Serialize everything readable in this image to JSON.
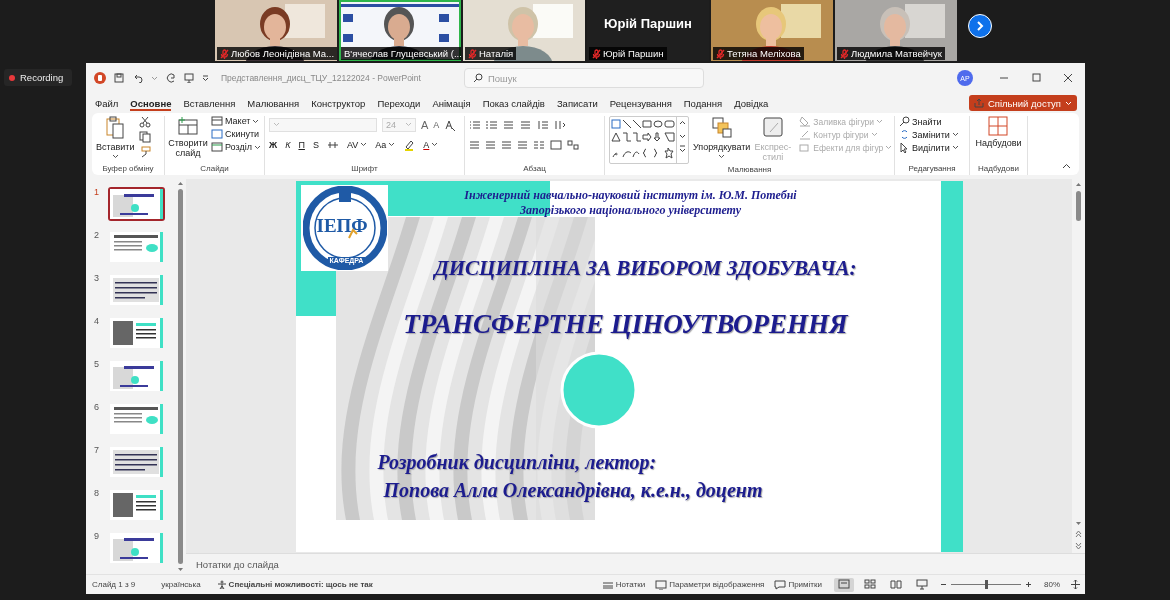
{
  "meeting": {
    "participants": [
      {
        "name": "Любов Леонідівна Ма...",
        "muted": true,
        "video_on": true,
        "speaking": false
      },
      {
        "name": "В'ячеслав Глущевський (...",
        "muted": false,
        "video_on": true,
        "speaking": true
      },
      {
        "name": "Наталія",
        "muted": true,
        "video_on": true,
        "speaking": false
      },
      {
        "name": "Юрій Паршин",
        "muted": true,
        "video_on": false,
        "speaking": false,
        "display_name": "Юрій Паршин"
      },
      {
        "name": "Тетяна Меліхова",
        "muted": true,
        "video_on": true,
        "speaking": false
      },
      {
        "name": "Людмила Матвейчук",
        "muted": true,
        "video_on": true,
        "speaking": false
      }
    ],
    "recording": {
      "label": "Recording"
    }
  },
  "window": {
    "title": "Представлення_дисц_ТЦУ_12122024  -  PowerPoint",
    "search": {
      "placeholder": "Пошук"
    },
    "avatar": "AP",
    "tabs": [
      {
        "label": "Файл",
        "selected": false
      },
      {
        "label": "Основне",
        "selected": true
      },
      {
        "label": "Вставлення",
        "selected": false
      },
      {
        "label": "Малювання",
        "selected": false
      },
      {
        "label": "Конструктор",
        "selected": false
      },
      {
        "label": "Переходи",
        "selected": false
      },
      {
        "label": "Анімація",
        "selected": false
      },
      {
        "label": "Показ слайдів",
        "selected": false
      },
      {
        "label": "Записати",
        "selected": false
      },
      {
        "label": "Рецензування",
        "selected": false
      },
      {
        "label": "Подання",
        "selected": false
      },
      {
        "label": "Довідка",
        "selected": false
      }
    ],
    "share_button": "Спільний доступ"
  },
  "ribbon": {
    "clipboard": {
      "label": "Буфер обміну",
      "paste": "Вставити"
    },
    "slides": {
      "label": "Слайди",
      "new_slide": "Створити слайд",
      "layout": "Макет",
      "reset": "Скинути",
      "section": "Розділ"
    },
    "font": {
      "label": "Шрифт",
      "size": "24",
      "grow": "A",
      "shrink": "A",
      "bold": "Ж",
      "italic": "К",
      "underline": "П",
      "strike": "S",
      "spacing": "AV",
      "case": "Aa",
      "font_color": "A"
    },
    "paragraph": {
      "label": "Абзац"
    },
    "drawing": {
      "label": "Малювання",
      "arrange": "Упорядкувати",
      "quick_styles": {
        "label": "Експрес-стилі",
        "disabled": true
      },
      "fill": {
        "label": "Заливка фігури",
        "disabled": true
      },
      "outline": {
        "label": "Контур фігури",
        "disabled": true
      },
      "effects": {
        "label": "Ефекти для фігур",
        "disabled": true
      }
    },
    "editing": {
      "label": "Редагування",
      "find": "Знайти",
      "replace": "Замінити",
      "select": "Виділити"
    },
    "addins": {
      "label": "Надбудови",
      "button": "Надбудови"
    }
  },
  "thumbnails": [
    {
      "number": "1",
      "selected": true
    },
    {
      "number": "2",
      "selected": false
    },
    {
      "number": "3",
      "selected": false
    },
    {
      "number": "4",
      "selected": false
    },
    {
      "number": "5",
      "selected": false
    },
    {
      "number": "6",
      "selected": false
    },
    {
      "number": "7",
      "selected": false
    },
    {
      "number": "8",
      "selected": false
    },
    {
      "number": "9",
      "selected": false
    }
  ],
  "slide": {
    "header": [
      "Інженерний навчально-науковий інститут ім. Ю.М. Потебні",
      "Запорізького національного університету"
    ],
    "logo": {
      "text": "ІЕПФ",
      "caption": "КАФЕДРА"
    },
    "title": "ДИСЦИПЛІНА ЗА ВИБОРОМ ЗДОБУВАЧА:",
    "subtitle": "ТРАНСФЕРТНЕ ЦІНОУТВОРЕННЯ",
    "author_lines": [
      "Розробник дисципліни, лектор:",
      "Попова Алла Олександрівна, к.е.н., доцент"
    ]
  },
  "notes_pane": {
    "placeholder": "Нотатки до слайда"
  },
  "status_bar": {
    "slide_info": "Слайд 1 з 9",
    "language": "українська",
    "accessibility": "Спеціальні можливості: щось не так",
    "notes": "Нотатки",
    "display_settings": "Параметри відображення",
    "comments": "Примітки",
    "views": [
      {
        "selected": true
      },
      {
        "selected": false
      },
      {
        "selected": false
      },
      {
        "selected": false
      }
    ],
    "zoom": {
      "level": 0.5,
      "reading": "80%"
    }
  }
}
